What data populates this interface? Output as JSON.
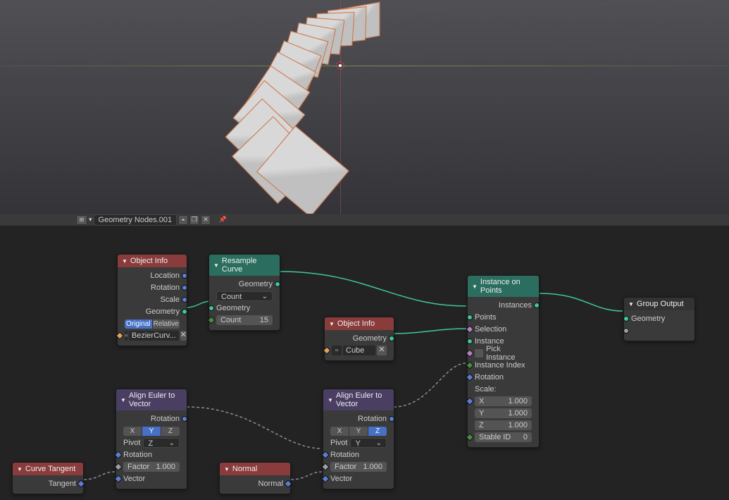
{
  "header": {
    "modifier_name": "Geometry Nodes.001"
  },
  "nodes": {
    "objInfo1": {
      "title": "Object Info",
      "outputs": [
        "Location",
        "Rotation",
        "Scale",
        "Geometry"
      ],
      "btn_original": "Original",
      "btn_relative": "Relative",
      "object": "BezierCurv..."
    },
    "objInfo2": {
      "title": "Object Info",
      "out_geo": "Geometry",
      "object": "Cube"
    },
    "resample": {
      "title": "Resample Curve",
      "out_geo": "Geometry",
      "in_geo": "Geometry",
      "mode": "Count",
      "count_label": "Count",
      "count_val": "15"
    },
    "align1": {
      "title": "Align Euler to Vector",
      "out_rot": "Rotation",
      "axisX": "X",
      "axisY": "Y",
      "axisZ": "Z",
      "pivot_label": "Pivot",
      "pivot_val": "Z",
      "in_rot": "Rotation",
      "factor_label": "Factor",
      "factor_val": "1.000",
      "in_vec": "Vector"
    },
    "align2": {
      "title": "Align Euler to Vector",
      "out_rot": "Rotation",
      "axisX": "X",
      "axisY": "Y",
      "axisZ": "Z",
      "pivot_label": "Pivot",
      "pivot_val": "Y",
      "in_rot": "Rotation",
      "factor_label": "Factor",
      "factor_val": "1.000",
      "in_vec": "Vector"
    },
    "curveTangent": {
      "title": "Curve Tangent",
      "out": "Tangent"
    },
    "normal": {
      "title": "Normal",
      "out": "Normal"
    },
    "instance": {
      "title": "Instance on Points",
      "out": "Instances",
      "in_points": "Points",
      "in_sel": "Selection",
      "in_inst": "Instance",
      "in_pick": "Pick Instance",
      "in_idx": "Instance Index",
      "in_rot": "Rotation",
      "scale_label": "Scale:",
      "sx_label": "X",
      "sx": "1.000",
      "sy_label": "Y",
      "sy": "1.000",
      "sz_label": "Z",
      "sz": "1.000",
      "stable_label": "Stable ID",
      "stable_val": "0"
    },
    "output": {
      "title": "Group Output",
      "in": "Geometry"
    }
  }
}
